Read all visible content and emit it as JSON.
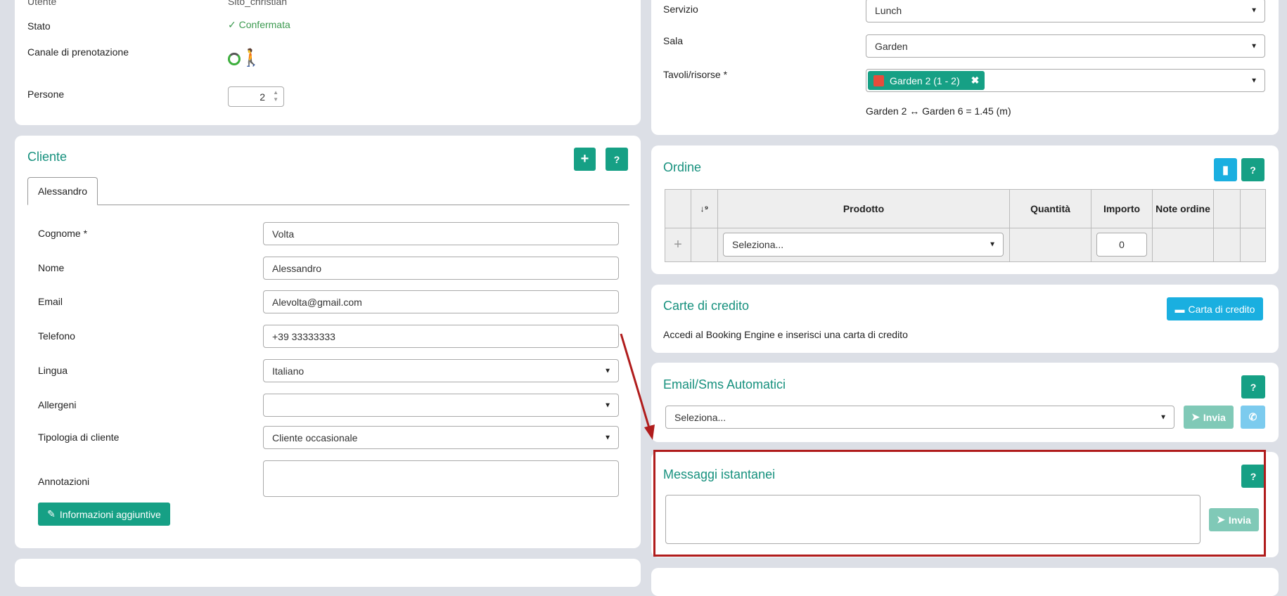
{
  "booking": {
    "utente_label": "Utente",
    "utente_value": "Sito_christian",
    "stato_label": "Stato",
    "stato_value": "Confermata",
    "canale_label": "Canale di prenotazione",
    "persone_label": "Persone",
    "persone_value": "2"
  },
  "service": {
    "servizio_label": "Servizio",
    "servizio_value": "Lunch",
    "sala_label": "Sala",
    "sala_value": "Garden",
    "tavoli_label": "Tavoli/risorse *",
    "tavolo_tag": "Garden 2 (1 - 2)",
    "distance": "Garden 2 ↔ Garden 6 = 1.45 (m)"
  },
  "cliente": {
    "title": "Cliente",
    "add": "+",
    "help": "?",
    "tab": "Alessandro",
    "fields": [
      {
        "label": "Cognome *",
        "value": "Volta"
      },
      {
        "label": "Nome",
        "value": "Alessandro"
      },
      {
        "label": "Email",
        "value": "Alevolta@gmail.com"
      },
      {
        "label": "Telefono",
        "value": "+39 33333333"
      },
      {
        "label": "Lingua",
        "value": "Italiano"
      },
      {
        "label": "Allergeni",
        "value": ""
      },
      {
        "label": "Tipologia di cliente",
        "value": "Cliente occasionale"
      },
      {
        "label": "Annotazioni",
        "value": ""
      }
    ],
    "info_button": "Informazioni aggiuntive"
  },
  "ordine": {
    "title": "Ordine",
    "help": "?",
    "headers": [
      "",
      "↓⁹",
      "Prodotto",
      "Quantità",
      "Importo",
      "Note ordine",
      "",
      ""
    ],
    "add": "+",
    "product_placeholder": "Seleziona...",
    "importo": "0"
  },
  "carte": {
    "title": "Carte di credito",
    "button": "Carta di credito",
    "text": "Accedi al Booking Engine e inserisci una carta di credito"
  },
  "email_sms": {
    "title": "Email/Sms Automatici",
    "help": "?",
    "select": "Seleziona...",
    "send": "Invia"
  },
  "messaggi": {
    "title": "Messaggi istantanei",
    "help": "?",
    "send": "Invia"
  },
  "colors": {
    "accent": "#16a085",
    "info": "#1aafe0",
    "highlight": "#b01c1c"
  }
}
